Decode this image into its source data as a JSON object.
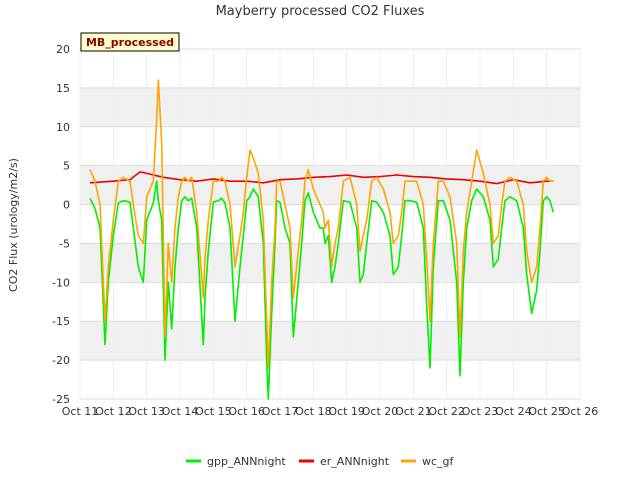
{
  "chart_data": {
    "type": "line",
    "title": "Mayberry processed CO2 Fluxes",
    "ylabel": "CO2 Flux (urology/m2/s)",
    "xlabel": "",
    "badge": "MB_processed",
    "ylim": [
      -25,
      20
    ],
    "yticks": [
      -25,
      -20,
      -15,
      -10,
      -5,
      0,
      5,
      10,
      15,
      20
    ],
    "xlim": [
      0,
      15
    ],
    "xticks": [
      "Oct 11",
      "Oct 12",
      "Oct 13",
      "Oct 14",
      "Oct 15",
      "Oct 16",
      "Oct 17",
      "Oct 18",
      "Oct 19",
      "Oct 20",
      "Oct 21",
      "Oct 22",
      "Oct 23",
      "Oct 24",
      "Oct 25",
      "Oct 26"
    ],
    "legend_position": "bottom",
    "grid": true,
    "series": [
      {
        "name": "gpp_ANNnight",
        "color": "#00ee00",
        "x": [
          0.3,
          0.45,
          0.6,
          0.65,
          0.75,
          0.85,
          1.0,
          1.15,
          1.3,
          1.5,
          1.6,
          1.75,
          1.9,
          2.0,
          2.2,
          2.3,
          2.35,
          2.45,
          2.55,
          2.65,
          2.75,
          2.85,
          2.95,
          3.05,
          3.15,
          3.25,
          3.35,
          3.5,
          3.7,
          3.75,
          3.85,
          4.0,
          4.15,
          4.25,
          4.35,
          4.5,
          4.65,
          4.8,
          4.9,
          5.0,
          5.1,
          5.2,
          5.35,
          5.5,
          5.6,
          5.65,
          5.75,
          5.85,
          5.9,
          6.0,
          6.15,
          6.3,
          6.4,
          6.55,
          6.65,
          6.75,
          6.85,
          7.0,
          7.2,
          7.3,
          7.35,
          7.45,
          7.55,
          7.65,
          7.75,
          7.9,
          8.1,
          8.3,
          8.4,
          8.5,
          8.6,
          8.75,
          8.9,
          9.1,
          9.3,
          9.4,
          9.55,
          9.65,
          9.75,
          9.9,
          10.1,
          10.3,
          10.4,
          10.5,
          10.6,
          10.75,
          10.9,
          11.1,
          11.3,
          11.4,
          11.5,
          11.6,
          11.75,
          11.9,
          12.1,
          12.3,
          12.4,
          12.55,
          12.65,
          12.75,
          12.9,
          13.1,
          13.3,
          13.4,
          13.55,
          13.7,
          13.8,
          13.9,
          14.0,
          14.1,
          14.2
        ],
        "y": [
          0.8,
          -0.5,
          -3,
          -8,
          -18,
          -10,
          -4,
          0.2,
          0.5,
          0.3,
          -3,
          -8,
          -10,
          -2,
          0.2,
          3,
          0.5,
          -2,
          -20,
          -10,
          -16,
          -8,
          -3,
          0.5,
          1,
          0.5,
          0.8,
          -3,
          -18,
          -12,
          -6,
          0.3,
          0.5,
          0.8,
          0.2,
          -3,
          -15,
          -8,
          -4,
          0.5,
          1,
          2,
          1,
          -5,
          -20,
          -25,
          -14,
          -5,
          0.5,
          0.3,
          -3,
          -5,
          -17,
          -10,
          -5,
          0.5,
          1.5,
          -1,
          -3,
          -3,
          -5,
          -4,
          -10,
          -8,
          -5,
          0.5,
          0.3,
          -3,
          -10,
          -9,
          -5,
          0.5,
          0.3,
          -1,
          -4,
          -9,
          -8,
          -4,
          0.5,
          0.5,
          0.3,
          -3,
          -13,
          -21,
          -8,
          0.5,
          0.5,
          -2,
          -10,
          -22,
          -10,
          -3,
          0.5,
          2,
          1,
          -2,
          -8,
          -7,
          -3,
          0.5,
          1,
          0.5,
          -3,
          -9,
          -14,
          -11,
          -6,
          0.5,
          1,
          0.5,
          -1
        ]
      },
      {
        "name": "er_ANNnight",
        "color": "#ee0000",
        "x": [
          0.3,
          1.0,
          1.5,
          1.8,
          2.0,
          2.5,
          3.0,
          3.5,
          4.0,
          4.5,
          5.0,
          5.5,
          6.0,
          6.5,
          7.0,
          7.5,
          8.0,
          8.5,
          9.0,
          9.5,
          10.0,
          10.5,
          11.0,
          11.5,
          12.0,
          12.5,
          13.0,
          13.5,
          14.0,
          14.2
        ],
        "y": [
          2.8,
          3.0,
          3.2,
          4.2,
          4.0,
          3.5,
          3.2,
          3.0,
          3.3,
          3.0,
          3.0,
          2.8,
          3.2,
          3.3,
          3.5,
          3.6,
          3.8,
          3.5,
          3.6,
          3.8,
          3.6,
          3.5,
          3.3,
          3.2,
          3.0,
          2.7,
          3.2,
          2.8,
          3.0,
          3.0
        ]
      },
      {
        "name": "wc_gf",
        "color": "#ffa500",
        "x": [
          0.3,
          0.45,
          0.6,
          0.65,
          0.75,
          0.85,
          1.0,
          1.15,
          1.3,
          1.5,
          1.6,
          1.75,
          1.9,
          2.0,
          2.2,
          2.3,
          2.35,
          2.45,
          2.55,
          2.65,
          2.75,
          2.85,
          2.95,
          3.05,
          3.15,
          3.25,
          3.35,
          3.5,
          3.7,
          3.75,
          3.85,
          4.0,
          4.15,
          4.25,
          4.35,
          4.5,
          4.65,
          4.8,
          4.9,
          5.0,
          5.1,
          5.2,
          5.35,
          5.5,
          5.6,
          5.65,
          5.75,
          5.85,
          5.9,
          6.0,
          6.15,
          6.3,
          6.4,
          6.55,
          6.65,
          6.75,
          6.85,
          7.0,
          7.2,
          7.3,
          7.35,
          7.45,
          7.55,
          7.65,
          7.75,
          7.9,
          8.1,
          8.3,
          8.4,
          8.5,
          8.6,
          8.75,
          8.9,
          9.1,
          9.3,
          9.4,
          9.55,
          9.65,
          9.75,
          9.9,
          10.1,
          10.3,
          10.4,
          10.5,
          10.6,
          10.75,
          10.9,
          11.1,
          11.3,
          11.4,
          11.5,
          11.6,
          11.75,
          11.9,
          12.1,
          12.3,
          12.4,
          12.55,
          12.65,
          12.75,
          12.9,
          13.1,
          13.3,
          13.4,
          13.55,
          13.7,
          13.8,
          13.9,
          14.0,
          14.1,
          14.2
        ],
        "y": [
          4.5,
          3,
          0,
          -5,
          -15,
          -8,
          -2,
          3,
          3.5,
          3,
          0,
          -4,
          -5,
          1,
          3,
          11,
          16,
          8,
          -17,
          -5,
          -10,
          -3,
          1,
          3,
          3.5,
          3,
          3.5,
          -1,
          -12,
          -7,
          -2,
          3,
          3,
          3.5,
          3,
          0,
          -8,
          -4,
          -1,
          3.5,
          7,
          6,
          4,
          -2,
          -15,
          -21,
          -10,
          -3,
          3,
          3,
          0,
          -3,
          -12,
          -6,
          -2,
          3,
          4.5,
          2,
          0,
          -1,
          -3,
          -2,
          -8,
          -5,
          -3,
          3,
          3.5,
          0,
          -6,
          -4,
          -2,
          3,
          3.5,
          2,
          -1,
          -5,
          -4,
          -1,
          3,
          3,
          3,
          0,
          -7,
          -15,
          -5,
          3,
          3,
          1,
          -5,
          -17,
          -6,
          -1,
          3,
          7,
          4,
          0,
          -5,
          -4,
          0,
          3,
          3.5,
          3,
          0,
          -6,
          -10,
          -8,
          -3,
          3,
          3.5,
          3,
          3
        ]
      }
    ]
  }
}
